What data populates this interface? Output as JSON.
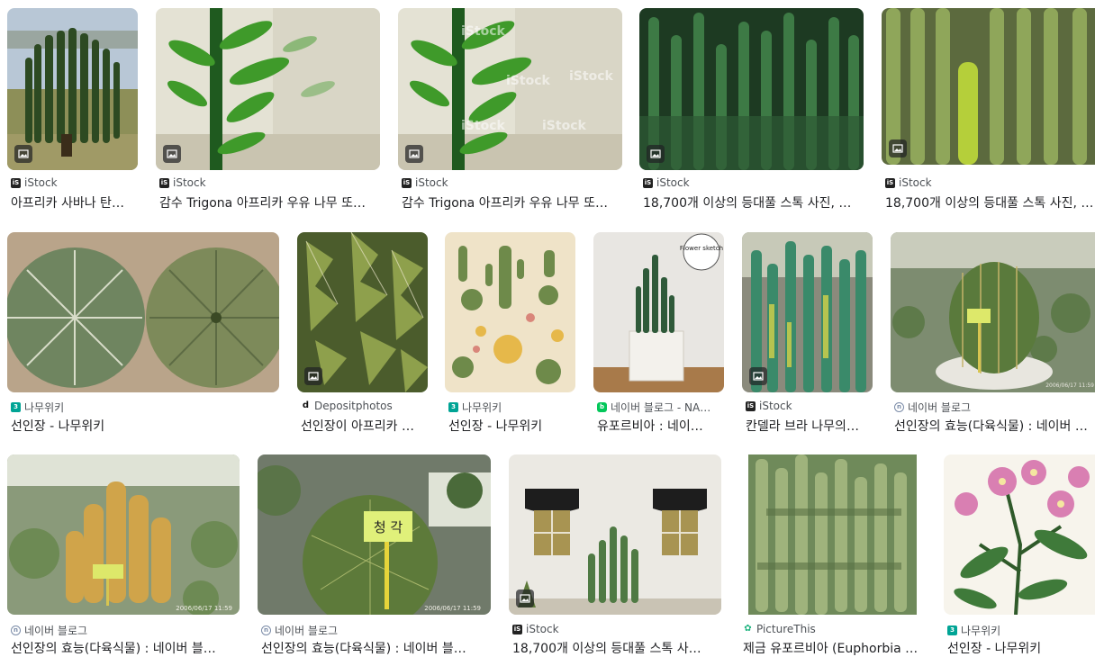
{
  "results": [
    {
      "source": "iStock",
      "favicon": "istock-icon",
      "title": "아프리카 사바나 탄…",
      "image": "tall candelabra euphorbia tree in savanna"
    },
    {
      "source": "iStock",
      "favicon": "istock-icon",
      "title": "감수 Trigona 아프리카 우유 나무 또…",
      "image": "euphorbia trigona leaves close-up"
    },
    {
      "source": "iStock",
      "favicon": "istock-icon",
      "title": "감수 Trigona 아프리카 우유 나무 또…",
      "image": "euphorbia trigona leaves close-up watermarked"
    },
    {
      "source": "iStock",
      "favicon": "istock-icon",
      "title": "18,700개 이상의 등대풀 스톡 사진, …",
      "image": "dense green euphorbia stems"
    },
    {
      "source": "iStock",
      "favicon": "istock-icon",
      "title": "18,700개 이상의 등대풀 스톡 사진, …",
      "image": "columnar cactus stems close-up"
    },
    {
      "source": "나무위키",
      "favicon": "namuwiki-icon",
      "title": "선인장 - 나무위키",
      "image": "two round star cacti"
    },
    {
      "source": "Depositphotos",
      "favicon": "depositphotos-icon",
      "title": "선인장이 아프리카 …",
      "image": "spiky succulent texture"
    },
    {
      "source": "나무위키",
      "favicon": "namuwiki-icon",
      "title": "선인장 - 나무위키",
      "image": "vintage cactus illustration chart"
    },
    {
      "source": "네이버 블로그 - NA…",
      "favicon": "naver-blog-icon",
      "title": "유포르비아 : 네이…",
      "image": "euphorbia in white concrete pot",
      "overlay": "Flower sketch"
    },
    {
      "source": "iStock",
      "favicon": "istock-icon",
      "title": "칸델라 브라 나무의…",
      "image": "candelabra tree stems in greenhouse"
    },
    {
      "source": "네이버 블로그",
      "favicon": "naver-icon",
      "title": "선인장의 효능(다육식물) : 네이버 …",
      "image": "barrel cactus in pot with label"
    },
    {
      "source": "네이버 블로그",
      "favicon": "naver-icon",
      "title": "선인장의 효능(다육식물) : 네이버 블…",
      "image": "golden hairy cactus in greenhouse",
      "overlay": "2006/06/17 11:59"
    },
    {
      "source": "네이버 블로그",
      "favicon": "naver-icon",
      "title": "선인장의 효능(다육식물) : 네이버 블…",
      "image": "round spiny cactus with yellow label",
      "label": "청 각",
      "overlay": "2006/06/17 11:59"
    },
    {
      "source": "iStock",
      "favicon": "istock-icon",
      "title": "18,700개 이상의 등대풀 스톡 사…",
      "image": "cactus by white wall with awning windows"
    },
    {
      "source": "PictureThis",
      "favicon": "picturethis-icon",
      "title": "제금 유포르비아 (Euphorbia …",
      "image": "dense euphorbia stems field"
    },
    {
      "source": "나무위키",
      "favicon": "namuwiki-icon",
      "title": "선인장 - 나무위키",
      "image": "pink flower botanical illustration"
    }
  ]
}
